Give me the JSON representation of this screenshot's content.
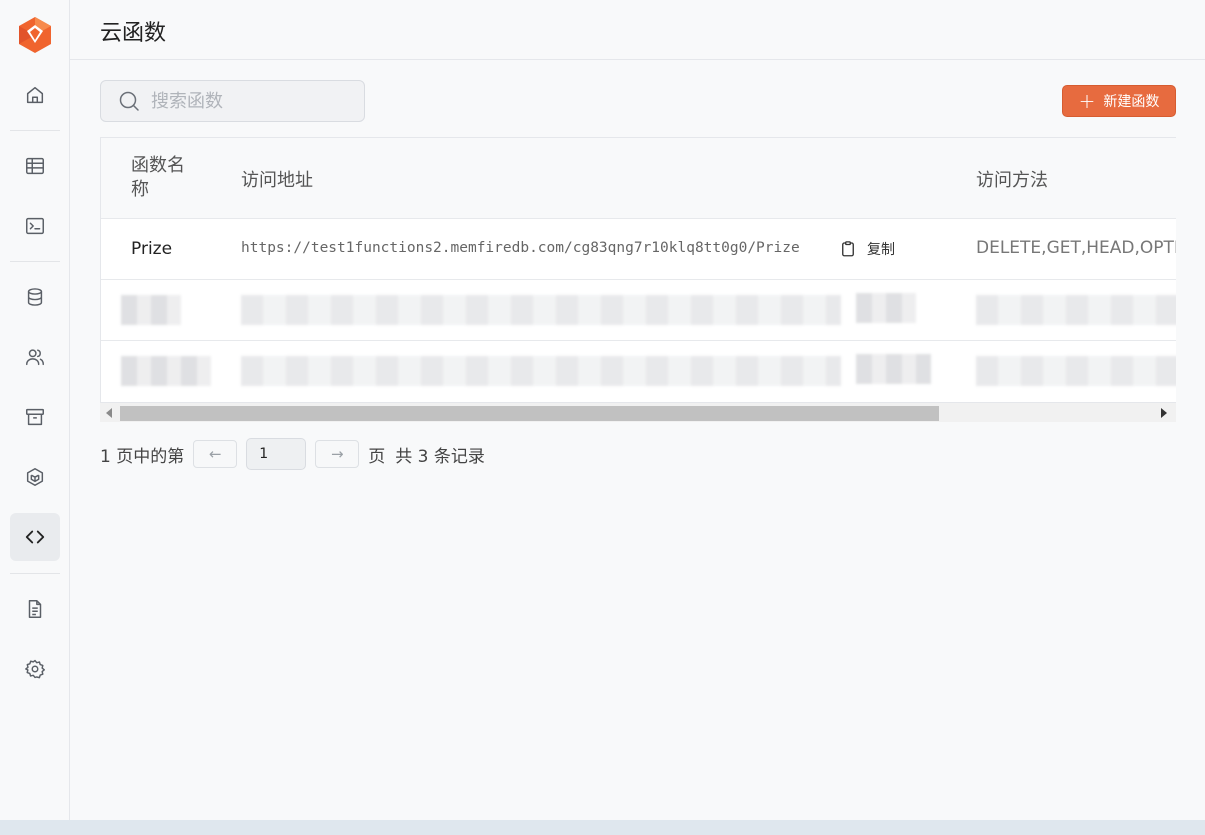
{
  "header": {
    "title": "云函数"
  },
  "sidebar": {
    "items": [
      {
        "name": "home",
        "icon": "home-icon"
      },
      {
        "name": "table",
        "icon": "table-icon"
      },
      {
        "name": "sql",
        "icon": "terminal-icon"
      },
      {
        "name": "database",
        "icon": "database-icon"
      },
      {
        "name": "users",
        "icon": "users-icon"
      },
      {
        "name": "storage",
        "icon": "archive-icon"
      },
      {
        "name": "api",
        "icon": "cube-icon"
      },
      {
        "name": "functions",
        "icon": "code-icon",
        "active": true
      },
      {
        "name": "docs",
        "icon": "document-icon"
      },
      {
        "name": "settings",
        "icon": "gear-icon"
      }
    ]
  },
  "search": {
    "placeholder": "搜索函数"
  },
  "toolbar": {
    "new_label": "新建函数"
  },
  "table": {
    "headers": {
      "name": "函数名称",
      "url": "访问地址",
      "method": "访问方法"
    },
    "rows": [
      {
        "name": "Prize",
        "url": "https://test1functions2.memfiredb.com/cg83qng7r10klq8tt0g0/Prize",
        "copy_label": "复制",
        "method": "DELETE,GET,HEAD,OPTIO"
      }
    ]
  },
  "pagination": {
    "prefix": "1 页中的第",
    "current": "1",
    "suffix": "页",
    "total": "共 3 条记录",
    "prev": "←",
    "next": "→"
  },
  "colors": {
    "accent": "#e76b3f",
    "active_nav_bg": "#e9ebee"
  }
}
